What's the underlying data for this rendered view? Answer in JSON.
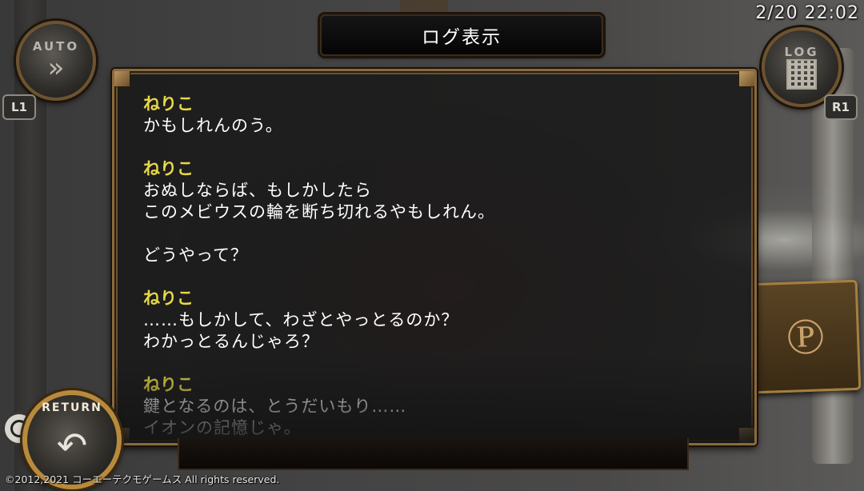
{
  "status": {
    "clock": "2/20 22:02"
  },
  "header": {
    "title": "ログ表示"
  },
  "controls": {
    "auto_label": "AUTO",
    "auto_icon": "fast-forward-icon",
    "l1_label": "L1",
    "log_label": "LOG",
    "log_icon": "log-document-icon",
    "r1_label": "R1",
    "return_label": "RETURN",
    "return_icon": "return-arrow-icon",
    "circle_icon": "circle-button-icon"
  },
  "log": {
    "entries": [
      {
        "speaker": "ねりこ",
        "lines": [
          "かもしれんのう。"
        ]
      },
      {
        "speaker": "ねりこ",
        "lines": [
          "おぬしならば、もしかしたら",
          "このメビウスの輪を断ち切れるやもしれん。"
        ]
      },
      {
        "speaker": "",
        "lines": [
          "どうやって？"
        ]
      },
      {
        "speaker": "ねりこ",
        "lines": [
          "……もしかして、わざとやっとるのか？",
          "わかっとるんじゃろ？"
        ]
      },
      {
        "speaker": "ねりこ",
        "lines": [
          "鍵となるのは、とうだいもり……",
          "イオンの記憶じゃ。"
        ]
      }
    ]
  },
  "footer": {
    "copyright": "©2012,2021 コーエーテクモゲームス All rights reserved."
  },
  "colors": {
    "speaker": "#e6d84a",
    "text": "#ffffff",
    "frame": "#8a6a3e"
  }
}
